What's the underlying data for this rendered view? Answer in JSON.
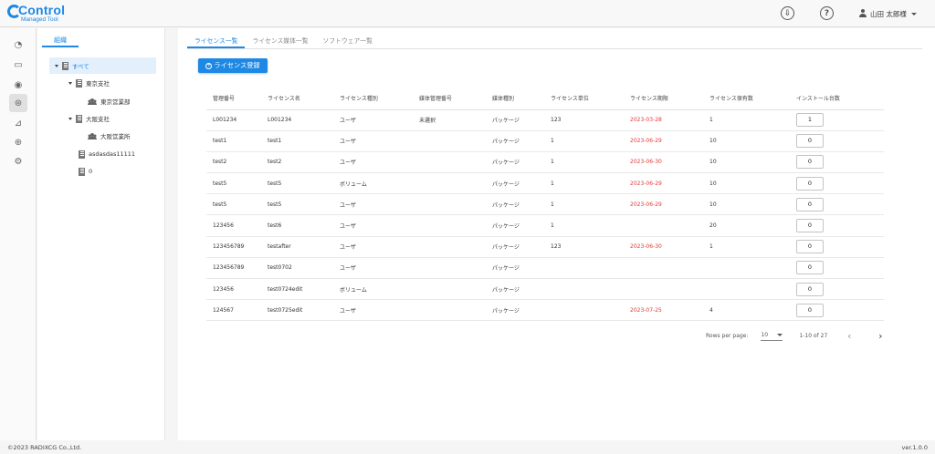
{
  "header": {
    "logo_title": "Control",
    "logo_subtitle": "Managed Tool",
    "download_icon": "download-circle-icon",
    "help_icon": "help-circle-icon",
    "user_name": "山田 太郎様"
  },
  "rail": {
    "items": [
      "dashboard-gauge-icon",
      "laptop-icon",
      "disc-icon",
      "license-badge-icon",
      "chart-icon",
      "download-icon",
      "user-settings-icon"
    ],
    "active": "license-badge-icon"
  },
  "tree": {
    "tab_label": "組織",
    "nodes": [
      {
        "label": "すべて",
        "type": "building-group",
        "expanded": true,
        "selected": true
      },
      {
        "label": "東京支社",
        "type": "building",
        "expanded": true
      },
      {
        "label": "東京営業部",
        "type": "people"
      },
      {
        "label": "大阪支社",
        "type": "building",
        "expanded": true
      },
      {
        "label": "大阪営業所",
        "type": "people"
      },
      {
        "label": "asdasdas11111",
        "type": "building"
      },
      {
        "label": "0",
        "type": "building"
      }
    ]
  },
  "main": {
    "tabs": [
      "ライセンス一覧",
      "ライセンス媒体一覧",
      "ソフトウェア一覧"
    ],
    "active_tab": 0,
    "add_button_label": "ライセンス登録",
    "table": {
      "headers": [
        "管理番号",
        "ライセンス名",
        "ライセンス種別",
        "媒体管理番号",
        "媒体種別",
        "ライセンス単位",
        "ライセンス期限",
        "ライセンス保有数",
        "インストール台数"
      ],
      "rows": [
        [
          "L001234",
          "L001234",
          "ユーザ",
          "未選択",
          "パッケージ",
          "123",
          "2023-03-28",
          "1",
          "1"
        ],
        [
          "test1",
          "test1",
          "ユーザ",
          "",
          "パッケージ",
          "1",
          "2023-06-29",
          "10",
          "0"
        ],
        [
          "test2",
          "test2",
          "ユーザ",
          "",
          "パッケージ",
          "1",
          "2023-06-30",
          "10",
          "0"
        ],
        [
          "test5",
          "test5",
          "ボリューム",
          "",
          "パッケージ",
          "1",
          "2023-06-29",
          "10",
          "0"
        ],
        [
          "test5",
          "test5",
          "ユーザ",
          "",
          "パッケージ",
          "1",
          "2023-06-29",
          "10",
          "0"
        ],
        [
          "123456",
          "test6",
          "ユーザ",
          "",
          "パッケージ",
          "1",
          "",
          "20",
          "0"
        ],
        [
          "123456789",
          "testafter",
          "ユーザ",
          "",
          "パッケージ",
          "123",
          "2023-06-30",
          "1",
          "0"
        ],
        [
          "123456789",
          "test0702",
          "ユーザ",
          "",
          "パッケージ",
          "",
          "",
          "",
          "0"
        ],
        [
          "123456",
          "test0724edit",
          "ボリューム",
          "",
          "パッケージ",
          "",
          "",
          "",
          "0"
        ],
        [
          "124567",
          "test0725edit",
          "ユーザ",
          "",
          "パッケージ",
          "",
          "2023-07-25",
          "4",
          "0"
        ]
      ]
    },
    "pager": {
      "rows_per_page_label": "Rows per page:",
      "rows_per_page": "10",
      "range": "1-10 of 27",
      "prev": "‹",
      "next": "›"
    }
  },
  "colors": {
    "accent": "#1e88e5",
    "expired": "#e53935"
  },
  "footer": {
    "copyright": "©2023 RADIXCG Co.,Ltd.",
    "version": "ver.1.0.0"
  }
}
